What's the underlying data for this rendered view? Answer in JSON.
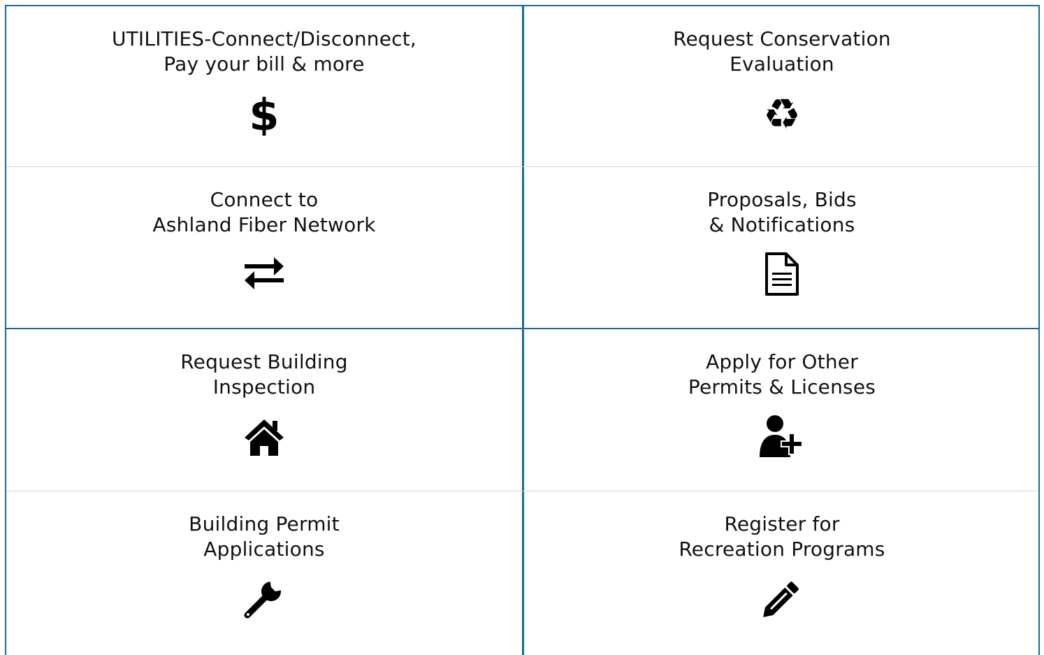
{
  "tiles": [
    {
      "line1": "UTILITIES-Connect/Disconnect,",
      "line2": "Pay your bill & more",
      "icon": "dollar-icon"
    },
    {
      "line1": "Request Conservation",
      "line2": "Evaluation",
      "icon": "recycle-icon"
    },
    {
      "line1": "Connect to",
      "line2": "Ashland Fiber Network",
      "icon": "exchange-arrows-icon"
    },
    {
      "line1": "Proposals, Bids",
      "line2": "& Notifications",
      "icon": "document-icon"
    },
    {
      "line1": "Request Building",
      "line2": "Inspection",
      "icon": "house-icon"
    },
    {
      "line1": "Apply for Other",
      "line2": "Permits & Licenses",
      "icon": "add-user-icon"
    },
    {
      "line1": "Building Permit",
      "line2": "Applications",
      "icon": "wrench-icon"
    },
    {
      "line1": "Register for",
      "line2": "Recreation Programs",
      "icon": "pencil-icon"
    }
  ],
  "colors": {
    "border_accent": "#1b6a96",
    "row_divider": "#d7d7d7",
    "text": "#111111",
    "icon": "#000000"
  }
}
